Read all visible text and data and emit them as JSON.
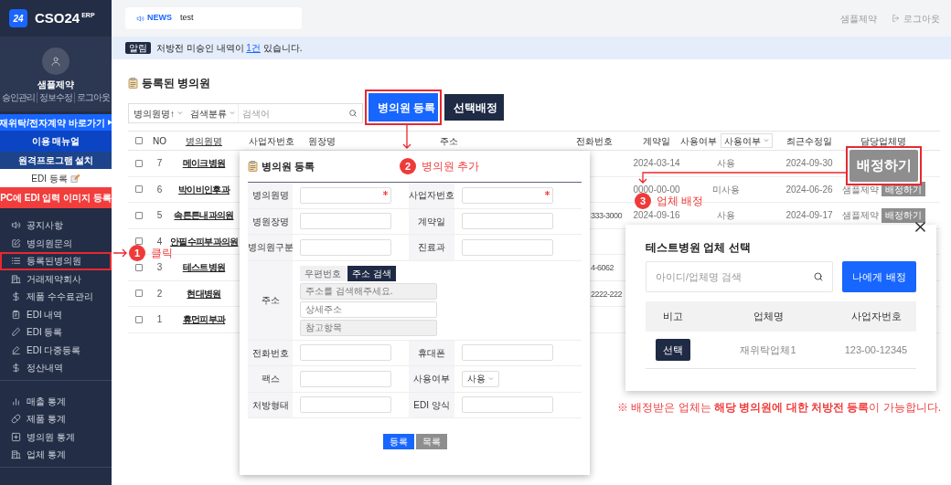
{
  "sidebar": {
    "logo": {
      "badge": "24",
      "name": "CSO24",
      "suffix": "ERP"
    },
    "profile": {
      "name": "샘플제약",
      "links": [
        "승인관리",
        "정보수정",
        "로그아웃"
      ]
    },
    "quick_links": [
      {
        "label": "재위탁/전자계약 바로가기",
        "kind": "shortcut"
      },
      {
        "label": "이용 매뉴얼",
        "kind": "manual"
      },
      {
        "label": "원격프로그램 설치",
        "kind": "install"
      },
      {
        "label": "EDI 등록",
        "kind": "edi"
      },
      {
        "label": "PC에 EDI 입력 이미지 등록",
        "kind": "upload"
      }
    ],
    "menu_groups": [
      {
        "items": [
          {
            "label": "공지사항",
            "annotated": false
          },
          {
            "label": "병의원문의",
            "annotated": false
          },
          {
            "label": "등록된병의원",
            "annotated": true
          },
          {
            "label": "거래제약회사",
            "annotated": false
          },
          {
            "label": "제품 수수료관리",
            "annotated": false
          },
          {
            "label": "EDI 내역",
            "annotated": false
          },
          {
            "label": "EDI 등록",
            "annotated": false
          },
          {
            "label": "EDI 다중등록",
            "annotated": false
          },
          {
            "label": "정산내역",
            "annotated": false
          }
        ]
      },
      {
        "items": [
          {
            "label": "매출 통계",
            "annotated": false
          },
          {
            "label": "제품 통계",
            "annotated": false
          },
          {
            "label": "병의원 통계",
            "annotated": false
          },
          {
            "label": "업체 통계",
            "annotated": false
          }
        ]
      }
    ]
  },
  "topbar": {
    "news_label": "NEWS",
    "news_text": "test",
    "user": "샘플제약",
    "logout": "로그아웃"
  },
  "alert": {
    "badge": "알림",
    "before": "처방전 미승인 내역이 ",
    "link": "1건",
    "after": " 있습니다."
  },
  "page": {
    "title": "등록된 병의원",
    "search": {
      "sort": "병의원명↑",
      "category": "검색분류",
      "placeholder": "검색어"
    },
    "buttons": [
      {
        "label": "병의원 등록",
        "kind": "primary",
        "annotated": true
      },
      {
        "label": "선택배정",
        "kind": "dark",
        "annotated": false
      }
    ]
  },
  "table": {
    "all_checked": false,
    "columns": [
      {
        "label": "NO",
        "kind": "text"
      },
      {
        "label": "병의원명",
        "kind": "link"
      },
      {
        "label": "사업자번호",
        "kind": "text"
      },
      {
        "label": "원장명",
        "kind": "text"
      },
      {
        "label": "주소",
        "kind": "text"
      },
      {
        "label": "전화번호",
        "kind": "text"
      },
      {
        "label": "계약일",
        "kind": "text"
      },
      {
        "label": "사용여부",
        "kind": "filter",
        "filter": "사용여부"
      },
      {
        "label": "최근수정일",
        "kind": "text"
      },
      {
        "label": "담당업체명",
        "kind": "text"
      }
    ],
    "rows": [
      {
        "checked": false,
        "no": "7",
        "name": "메이크병원",
        "contract": "2024-03-14",
        "usage": "사용",
        "modified": "2024-09-30"
      },
      {
        "checked": false,
        "no": "6",
        "name": "박이비인후과",
        "contract": "0000-00-00",
        "usage": "미사용",
        "modified": "2024-06-26",
        "company": "샘플제약",
        "assign": "배정하기"
      },
      {
        "checked": false,
        "no": "5",
        "name": "속튼튼내과의원",
        "phone": "333-3000",
        "contract": "2024-09-16",
        "usage": "사용",
        "modified": "2024-09-17",
        "company": "샘플제약",
        "assign": "배정하기"
      },
      {
        "checked": false,
        "no": "4",
        "name": "안필수피부과의원"
      },
      {
        "checked": false,
        "no": "3",
        "name": "테스트병원",
        "phone": "4-6062"
      },
      {
        "checked": false,
        "no": "2",
        "name": "현대병원",
        "phone": "2222-222"
      },
      {
        "checked": false,
        "no": "1",
        "name": "휴먼피부과"
      }
    ]
  },
  "registration": {
    "title": "병의원 등록",
    "rows": [
      {
        "kind": "pair",
        "cells": [
          {
            "label": "병의원명",
            "required": true
          },
          {
            "label": "사업자번호",
            "required": true
          }
        ]
      },
      {
        "kind": "pair",
        "cells": [
          {
            "label": "병원장명",
            "required": false
          },
          {
            "label": "계약일",
            "required": false
          }
        ]
      },
      {
        "kind": "pair",
        "cells": [
          {
            "label": "병의원구분",
            "required": false
          },
          {
            "label": "진료과",
            "required": false
          }
        ]
      },
      {
        "kind": "address",
        "label": "주소",
        "buttons": [
          {
            "label": "우편번호",
            "kind": "light"
          },
          {
            "label": "주소 검색",
            "kind": "dark"
          }
        ],
        "inputs": [
          {
            "placeholder": "주소를 검색해주세요.",
            "readonly": true
          },
          {
            "placeholder": "상세주소",
            "readonly": false
          },
          {
            "placeholder": "참고항목",
            "readonly": true
          }
        ]
      },
      {
        "kind": "pair",
        "cells": [
          {
            "label": "전화번호",
            "required": false
          },
          {
            "label": "휴대폰",
            "required": false
          }
        ]
      },
      {
        "kind": "pair",
        "cells": [
          {
            "label": "팩스",
            "required": false
          },
          {
            "label": "사용여부",
            "required": false,
            "value": "사용"
          }
        ]
      },
      {
        "kind": "pair",
        "cells": [
          {
            "label": "처방형태",
            "required": false
          },
          {
            "label": "EDI 양식",
            "required": false
          }
        ]
      }
    ],
    "actions": [
      {
        "label": "등록",
        "kind": "primary"
      },
      {
        "label": "목록",
        "kind": "secondary"
      }
    ]
  },
  "assign_popup": {
    "title": "테스트병원 업체 선택",
    "search_placeholder": "아이디/업체명 검색",
    "assign_button": "나에게 배정",
    "columns": [
      "비고",
      "업체명",
      "사업자번호"
    ],
    "rows": [
      {
        "action": "선택",
        "company": "재위탁업체1",
        "business_no": "123-00-12345"
      }
    ],
    "note": "※ 배정받은 업체는 **해당 병의원에 대한 처방전 등록**이 가능합니다."
  },
  "annotations": {
    "callout_button": "배정하기",
    "steps": [
      {
        "number": "1",
        "label": "클릭"
      },
      {
        "number": "2",
        "label": "병의원 추가"
      },
      {
        "number": "3",
        "label": "업체 배정"
      }
    ]
  }
}
